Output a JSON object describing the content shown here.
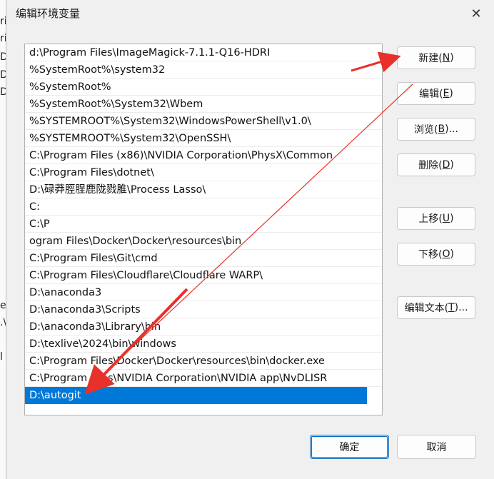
{
  "background_fragments": [
    "ri",
    "ri",
    "Da",
    "Da",
    "Da",
    "e",
    ".\\",
    "l"
  ],
  "dialog": {
    "title": "编辑环境变量",
    "close_glyph": "✕"
  },
  "paths": [
    "d:\\Program Files\\ImageMagick-7.1.1-Q16-HDRI",
    "%SystemRoot%\\system32",
    "%SystemRoot%",
    "%SystemRoot%\\System32\\Wbem",
    "%SYSTEMROOT%\\System32\\WindowsPowerShell\\v1.0\\",
    "%SYSTEMROOT%\\System32\\OpenSSH\\",
    "C:\\Program Files (x86)\\NVIDIA Corporation\\PhysX\\Common",
    "C:\\Program Files\\dotnet\\",
    "D:\\碌莽脛脭鹿陇戮脽\\Process Lasso\\",
    "C:",
    "C:\\P",
    "ogram Files\\Docker\\Docker\\resources\\bin",
    "C:\\Program Files\\Git\\cmd",
    "C:\\Program Files\\Cloudflare\\Cloudflare WARP\\",
    "D:\\anaconda3",
    "D:\\anaconda3\\Scripts",
    "D:\\anaconda3\\Library\\bin",
    "D:\\texlive\\2024\\bin\\windows",
    "C:\\Program Files\\Docker\\Docker\\resources\\bin\\docker.exe",
    "C:\\Program Files\\NVIDIA Corporation\\NVIDIA app\\NvDLISR",
    "D:\\autogit"
  ],
  "selected_path": "D:\\autogit",
  "buttons": {
    "new": {
      "label": "新建(",
      "key": "N",
      "end": ")"
    },
    "edit": {
      "label": "编辑(",
      "key": "E",
      "end": ")"
    },
    "browse": {
      "label": "浏览(",
      "key": "B",
      "end": ")..."
    },
    "delete": {
      "label": "删除(",
      "key": "D",
      "end": ")"
    },
    "move_up": {
      "label": "上移(",
      "key": "U",
      "end": ")"
    },
    "move_down": {
      "label": "下移(",
      "key": "O",
      "end": ")"
    },
    "edit_text": {
      "label": "编辑文本(",
      "key": "T",
      "end": ")..."
    },
    "ok": "确定",
    "cancel": "取消"
  },
  "annotation_color": "#e8312a"
}
